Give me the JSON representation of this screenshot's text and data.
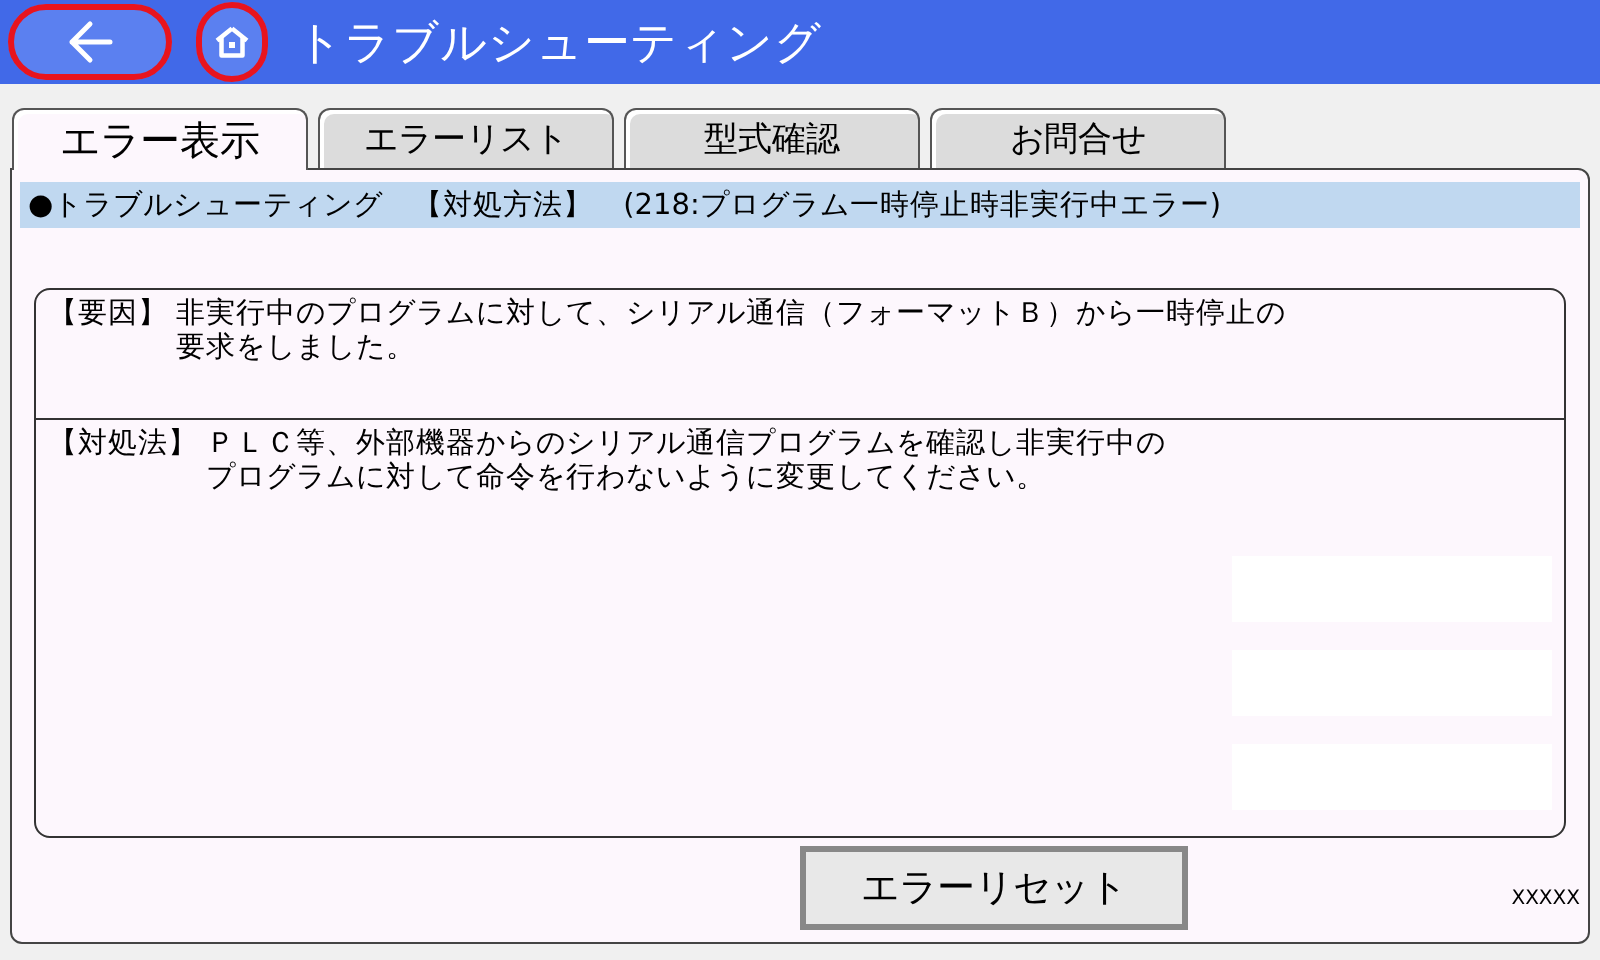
{
  "header": {
    "title": "トラブルシューティング",
    "back_button": {
      "highlighted": true
    },
    "home_button": {
      "highlighted": true
    }
  },
  "tabs": [
    {
      "label": "エラー表示",
      "selected": true
    },
    {
      "label": "エラーリスト",
      "selected": false
    },
    {
      "label": "型式確認",
      "selected": false
    },
    {
      "label": "お問合せ",
      "selected": false
    }
  ],
  "heading": "●トラブルシューティング　【対処方法】　(218:プログラム一時停止時非実行中エラー)",
  "sections": [
    {
      "label": "【要因】",
      "lines": [
        "非実行中のプログラムに対して、シリアル通信（フォーマットＢ）から一時停止の",
        "要求をしました。"
      ]
    },
    {
      "label": "【対処法】",
      "lines": [
        "ＰＬＣ等、外部機器からのシリアル通信プログラムを確認し非実行中の",
        "プログラムに対して命令を行わないように変更してください。"
      ]
    }
  ],
  "reset_button": "エラーリセット",
  "code": "XXXXX"
}
